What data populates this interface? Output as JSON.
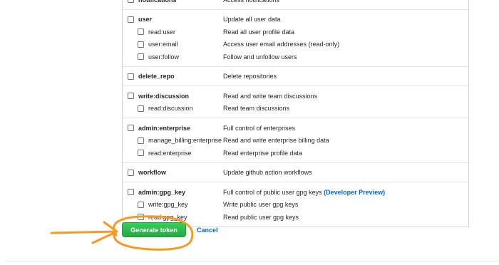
{
  "scope_groups": [
    {
      "rows": [
        {
          "name": "notifications",
          "description": "Access notifications"
        }
      ]
    },
    {
      "rows": [
        {
          "name": "user",
          "description": "Update all user data"
        },
        {
          "name": "read:user",
          "description": "Read all user profile data"
        },
        {
          "name": "user:email",
          "description": "Access user email addresses (read-only)"
        },
        {
          "name": "user:follow",
          "description": "Follow and unfollow users"
        }
      ]
    },
    {
      "rows": [
        {
          "name": "delete_repo",
          "description": "Delete repositories"
        }
      ]
    },
    {
      "rows": [
        {
          "name": "write:discussion",
          "description": "Read and write team discussions"
        },
        {
          "name": "read:discussion",
          "description": "Read team discussions"
        }
      ]
    },
    {
      "rows": [
        {
          "name": "admin:enterprise",
          "description": "Full control of enterprises"
        },
        {
          "name": "manage_billing:enterprise",
          "description": "Read and write enterprise billing data"
        },
        {
          "name": "read:enterprise",
          "description": "Read enterprise profile data"
        }
      ]
    },
    {
      "rows": [
        {
          "name": "workflow",
          "description": "Update github action workflows"
        }
      ]
    },
    {
      "rows": [
        {
          "name": "admin:gpg_key",
          "description": "Full control of public user gpg keys",
          "link": "(Developer Preview)"
        },
        {
          "name": "write:gpg_key",
          "description": "Write public user gpg keys"
        },
        {
          "name": "read:gpg_key",
          "description": "Read public user gpg keys"
        }
      ]
    }
  ],
  "actions": {
    "generate_label": "Generate token",
    "cancel_label": "Cancel"
  },
  "colors": {
    "primary_button": "#2ea44f",
    "link": "#0366d6",
    "annotation": "#f59a23"
  }
}
